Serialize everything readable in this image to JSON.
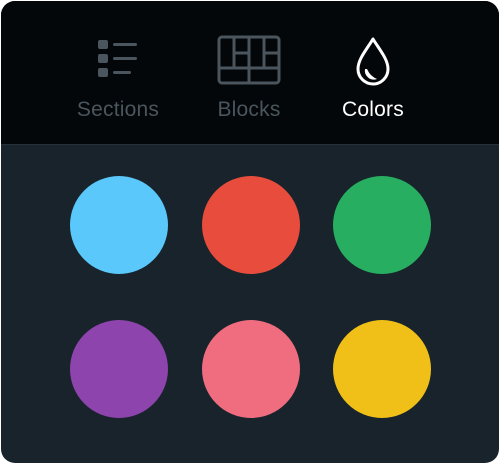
{
  "tabs": [
    {
      "label": "Sections",
      "icon": "list-icon",
      "active": false
    },
    {
      "label": "Blocks",
      "icon": "grid-blocks-icon",
      "active": false
    },
    {
      "label": "Colors",
      "icon": "drop-icon",
      "active": true
    }
  ],
  "colors": {
    "accent_active": "#ffffff",
    "inactive": "#4a555d",
    "tabbar_bg": "#03070a",
    "panel_bg": "#18232b"
  },
  "swatches": [
    {
      "name": "light-blue",
      "hex": "#5ac8fa"
    },
    {
      "name": "red",
      "hex": "#e74c3c"
    },
    {
      "name": "green",
      "hex": "#27ae60"
    },
    {
      "name": "purple",
      "hex": "#8e44ad"
    },
    {
      "name": "pink",
      "hex": "#f06d80"
    },
    {
      "name": "yellow",
      "hex": "#f0c018"
    }
  ]
}
